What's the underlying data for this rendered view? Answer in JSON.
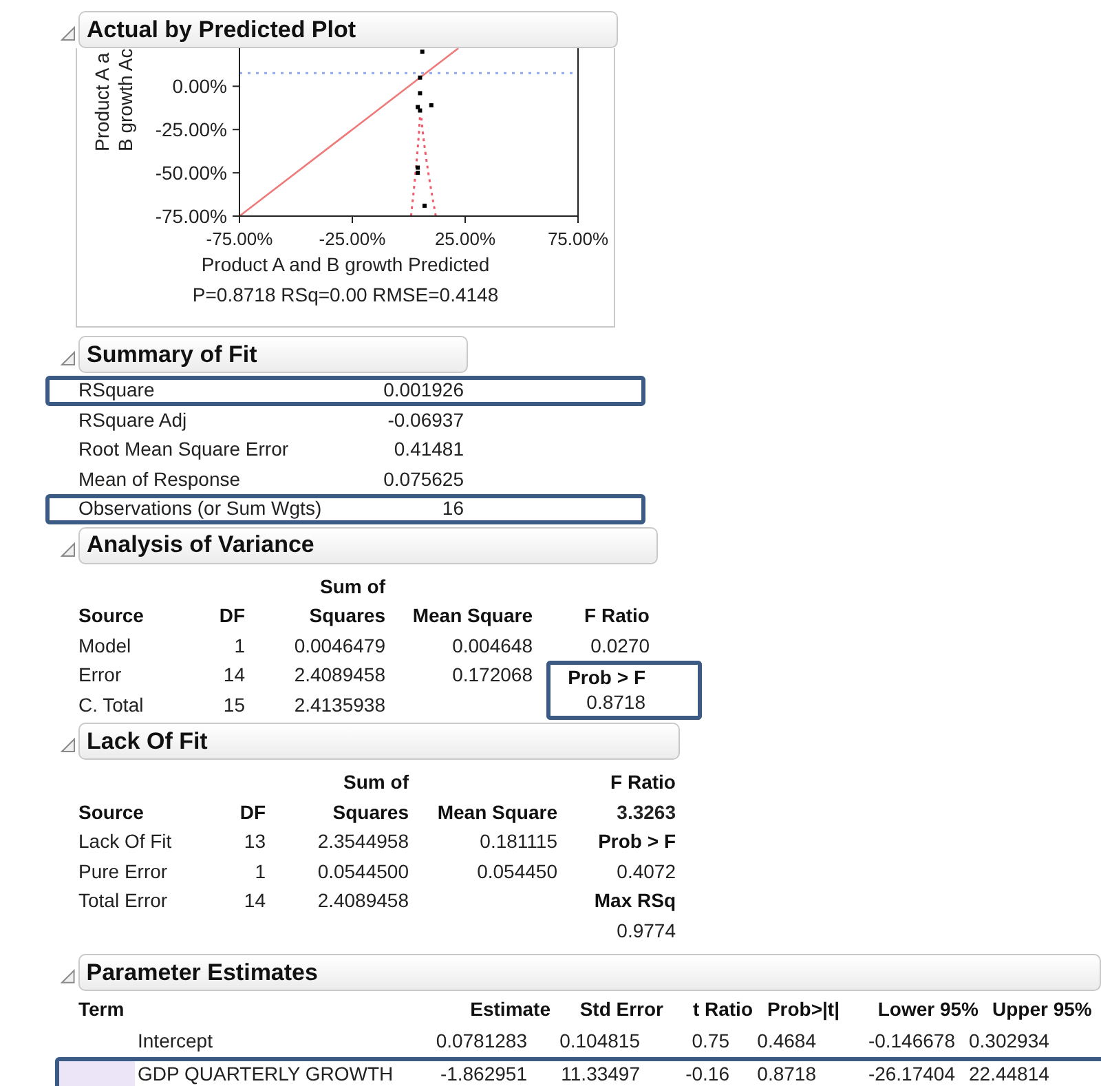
{
  "actual_by_predicted_plot": {
    "title": "Actual by Predicted Plot",
    "expanded": true,
    "ylabel_lines": [
      "Product A a",
      "B growth Ac"
    ],
    "caption": "P=0.8718 RSq=0.00 RMSE=0.4148",
    "chart_data": {
      "type": "scatter",
      "xlabel": "Product A and B growth Predicted",
      "x": [
        6,
        5,
        5,
        4,
        5,
        10,
        4,
        4,
        7
      ],
      "series": [
        {
          "color": "#000000",
          "values": [
            20,
            5,
            -4,
            -12,
            -14,
            -11,
            -47,
            -50,
            -69
          ]
        }
      ],
      "xlim": [
        -75,
        75
      ],
      "ylim": [
        -75,
        22
      ],
      "xticks": [
        {
          "value": -75,
          "label": "-75.00%"
        },
        {
          "value": -25,
          "label": "-25.00%"
        },
        {
          "value": 25,
          "label": "25.00%"
        },
        {
          "value": 75,
          "label": "75.00%"
        }
      ],
      "yticks": [
        {
          "value": 0,
          "label": "0.00%"
        },
        {
          "value": -25,
          "label": "-25.00%"
        },
        {
          "value": -50,
          "label": "-50.00%"
        },
        {
          "value": -75,
          "label": "-75.00%"
        }
      ]
    }
  },
  "summary_of_fit": {
    "title": "Summary of Fit",
    "expanded": true,
    "rows": [
      {
        "label": "RSquare",
        "value": "0.001926",
        "highlighted": true
      },
      {
        "label": "RSquare Adj",
        "value": "-0.06937",
        "highlighted": false
      },
      {
        "label": "Root Mean Square Error",
        "value": "0.41481",
        "highlighted": false
      },
      {
        "label": "Mean of Response",
        "value": "0.075625",
        "highlighted": false
      },
      {
        "label": "Observations (or Sum Wgts)",
        "value": "16",
        "highlighted": true
      }
    ]
  },
  "analysis_of_variance": {
    "title": "Analysis of Variance",
    "expanded": true,
    "rows": [
      {
        "kind": "header",
        "ss": "Sum of"
      },
      {
        "kind": "header",
        "source": "Source",
        "df": "DF",
        "ss": "Squares",
        "ms": "Mean Square",
        "stat": {
          "kind": "label",
          "text": "F Ratio",
          "highlighted": false
        }
      },
      {
        "kind": "data",
        "source": "Model",
        "df": "1",
        "ss": "0.0046479",
        "ms": "0.004648",
        "stat": {
          "kind": "value",
          "text": "0.0270",
          "highlighted": false
        }
      },
      {
        "kind": "data",
        "source": "Error",
        "df": "14",
        "ss": "2.4089458",
        "ms": "0.172068",
        "stat": {
          "kind": "label",
          "text": "Prob > F",
          "highlighted": true
        }
      },
      {
        "kind": "data",
        "source": "C. Total",
        "df": "15",
        "ss": "2.4135938",
        "stat": {
          "kind": "value",
          "text": "0.8718",
          "highlighted": true
        }
      }
    ]
  },
  "lack_of_fit": {
    "title": "Lack Of Fit",
    "expanded": true,
    "rows": [
      {
        "kind": "header",
        "ss": "Sum of",
        "stat": {
          "kind": "label",
          "text": "F Ratio",
          "highlighted": false
        }
      },
      {
        "kind": "header",
        "source": "Source",
        "df": "DF",
        "ss": "Squares",
        "ms": "Mean Square",
        "stat": {
          "kind": "value",
          "text": "3.3263",
          "highlighted": false
        }
      },
      {
        "kind": "data",
        "source": "Lack Of Fit",
        "df": "13",
        "ss": "2.3544958",
        "ms": "0.181115",
        "stat": {
          "kind": "label",
          "text": "Prob > F",
          "highlighted": false
        }
      },
      {
        "kind": "data",
        "source": "Pure Error",
        "df": "1",
        "ss": "0.0544500",
        "ms": "0.054450",
        "stat": {
          "kind": "value",
          "text": "0.4072",
          "highlighted": false
        }
      },
      {
        "kind": "data",
        "source": "Total Error",
        "df": "14",
        "ss": "2.4089458",
        "stat": {
          "kind": "label",
          "text": "Max RSq",
          "highlighted": false
        }
      },
      {
        "kind": "data",
        "stat": {
          "kind": "value",
          "text": "0.9774",
          "highlighted": false
        }
      }
    ]
  },
  "parameter_estimates": {
    "title": "Parameter Estimates",
    "expanded": true,
    "columns": [
      "Term",
      "Estimate",
      "Std Error",
      "t Ratio",
      "Prob>|t|",
      "Lower 95%",
      "Upper 95%"
    ],
    "rows": [
      {
        "cells": [
          "Intercept",
          "0.0781283",
          "0.104815",
          "0.75",
          "0.4684",
          "-0.146678",
          "0.302934"
        ],
        "highlighted": false
      },
      {
        "cells": [
          "GDP QUARTERLY GROWTH",
          "-1.862951",
          "11.33497",
          "-0.16",
          "0.8718",
          "-26.17404",
          "22.44814"
        ],
        "highlighted": true
      }
    ]
  }
}
